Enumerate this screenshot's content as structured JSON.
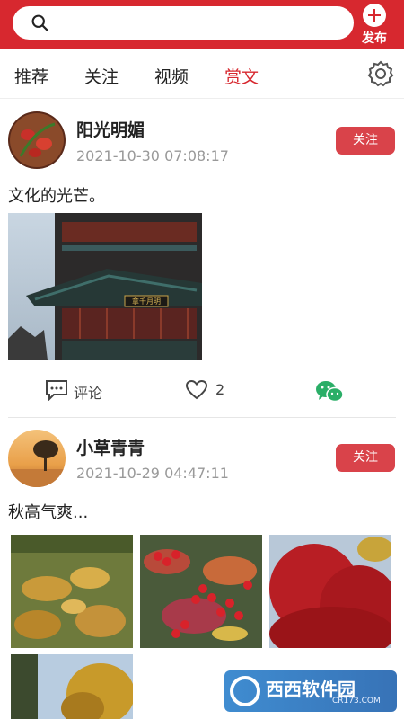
{
  "header": {
    "search_placeholder": "",
    "publish_label": "发布"
  },
  "tabs": [
    {
      "label": "推荐",
      "active": false
    },
    {
      "label": "关注",
      "active": false
    },
    {
      "label": "视频",
      "active": false
    },
    {
      "label": "赏文",
      "active": true
    }
  ],
  "posts": [
    {
      "username": "阳光明媚",
      "time": "2021-10-30 07:08:17",
      "follow_label": "关注",
      "text": "文化的光芒。",
      "sign_text": "拿千月明",
      "comment_label": "评论",
      "like_count": "2"
    },
    {
      "username": "小草青青",
      "time": "2021-10-29 04:47:11",
      "follow_label": "关注",
      "text": "秋高气爽..."
    }
  ],
  "watermark": {
    "text": "西西软件园",
    "sub": "CR173.COM"
  },
  "colors": {
    "brand_red": "#d7282f",
    "follow_red": "#d9434a",
    "wechat_green": "#2aae67"
  }
}
